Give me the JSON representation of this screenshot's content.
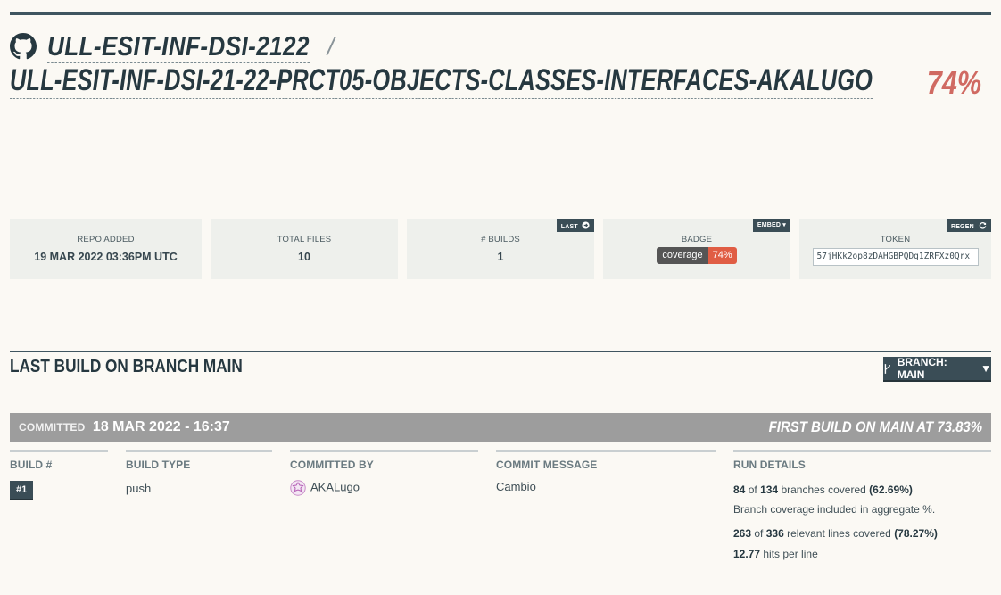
{
  "repo": {
    "owner": "ULL-ESIT-INF-DSI-2122",
    "separator": "/",
    "name": "ULL-ESIT-INF-DSI-21-22-PRCT05-OBJECTS-CLASSES-INTERFACES-AKALUGO",
    "coverage": "74%"
  },
  "stats": {
    "repo_added": {
      "label": "REPO ADDED",
      "value": "19 MAR 2022 03:36PM UTC"
    },
    "total_files": {
      "label": "TOTAL FILES",
      "value": "10"
    },
    "builds": {
      "label": "# BUILDS",
      "value": "1",
      "tag": "LAST"
    },
    "badge": {
      "label": "BADGE",
      "tag": "EMBED",
      "left": "coverage",
      "right": "74%"
    },
    "token": {
      "label": "TOKEN",
      "tag": "REGEN",
      "value": "57jHKk2op8zDAHGBPQDg1ZRFXz0Qrx"
    }
  },
  "last_build": {
    "title": "LAST BUILD ON BRANCH MAIN",
    "branch_button": "BRANCH: MAIN",
    "committed_label": "COMMITTED",
    "committed_date": "18 MAR 2022 - 16:37",
    "first_build": "FIRST BUILD ON MAIN AT 73.83%",
    "columns": {
      "build_num": {
        "head": "BUILD #",
        "value": "#1"
      },
      "build_type": {
        "head": "BUILD TYPE",
        "value": "push"
      },
      "committed_by": {
        "head": "COMMITTED BY",
        "value": "AKALugo"
      },
      "commit_message": {
        "head": "COMMIT MESSAGE",
        "value": "Cambio"
      },
      "run_details": {
        "head": "RUN DETAILS",
        "branches_covered": "84",
        "of1": "of",
        "branches_total": "134",
        "branches_text": "branches covered",
        "branches_pct": "(62.69%)",
        "aggregate_note": "Branch coverage included in aggregate %.",
        "lines_covered": "263",
        "of2": "of",
        "lines_total": "336",
        "lines_text": "relevant lines covered",
        "lines_pct": "(78.27%)",
        "hits": "12.77",
        "hits_text": "hits per line"
      }
    }
  },
  "colors": {
    "accent_dark": "#3a4d56",
    "coverage_red": "#d06a62",
    "badge_red": "#e05d44",
    "commit_bar": "#9d9d9d"
  },
  "icons": [
    "github-icon",
    "arrow-circle-right-icon",
    "caret-down-icon",
    "refresh-icon",
    "branch-icon"
  ]
}
